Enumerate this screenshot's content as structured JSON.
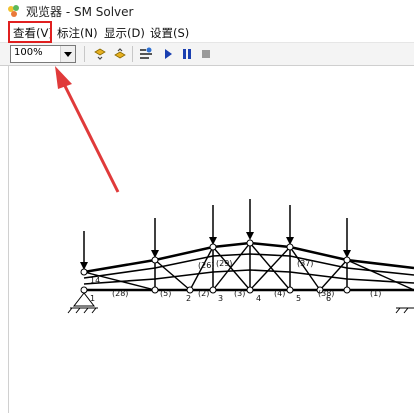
{
  "window": {
    "title": "观览器 - SM Solver"
  },
  "menu": [
    {
      "label": "查看(V)",
      "highlighted": true
    },
    {
      "label": "标注(N)"
    },
    {
      "label": "显示(D)"
    },
    {
      "label": "设置(S)"
    }
  ],
  "toolbar": {
    "zoom": "100%",
    "buttons": [
      "zoom-in-icon",
      "zoom-out-icon",
      "settings-icon",
      "play-icon",
      "pause-icon",
      "stop-icon"
    ]
  },
  "diagram": {
    "bottom_node_labels": [
      "1",
      "2",
      "3",
      "4",
      "5",
      "6"
    ],
    "member_labels": [
      "14",
      "(26)",
      "(28)",
      "(29)",
      "(37)",
      "(38)",
      "(5)",
      "(4)",
      "(3)",
      "(2)",
      "(1)"
    ]
  },
  "annotation": {
    "highlight_color": "#e02020",
    "arrow_color": "#e03a3a"
  }
}
